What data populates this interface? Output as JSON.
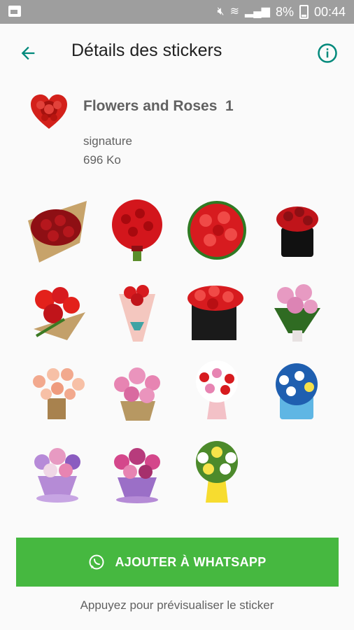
{
  "status_bar": {
    "battery_percent": "8%",
    "time": "00:44"
  },
  "app_bar": {
    "title": "Détails des stickers"
  },
  "pack": {
    "name": "Flowers and Roses  1",
    "publisher": "signature",
    "size": "696 Ko"
  },
  "stickers": [
    {
      "name": "sticker-red-roses-kraft-bouquet"
    },
    {
      "name": "sticker-red-roses-round-bouquet"
    },
    {
      "name": "sticker-red-roses-dome"
    },
    {
      "name": "sticker-red-roses-black-box"
    },
    {
      "name": "sticker-red-roses-spray"
    },
    {
      "name": "sticker-roses-pink-wrap"
    },
    {
      "name": "sticker-red-roses-black-square-box"
    },
    {
      "name": "sticker-pink-roses-bouquet"
    },
    {
      "name": "sticker-peach-roses-basket"
    },
    {
      "name": "sticker-pink-flowers-basket"
    },
    {
      "name": "sticker-mixed-flowers-vase"
    },
    {
      "name": "sticker-blue-flowers-box"
    },
    {
      "name": "sticker-purple-flowers-cup"
    },
    {
      "name": "sticker-pink-purple-flowers-cup"
    },
    {
      "name": "sticker-yellow-white-flowers-vase"
    }
  ],
  "add_button": {
    "label": "AJOUTER À WHATSAPP"
  },
  "hint": "Appuyez pour prévisualiser le sticker",
  "colors": {
    "accent": "#00897b",
    "button": "#46b840",
    "status_bar": "#9e9e9e"
  }
}
